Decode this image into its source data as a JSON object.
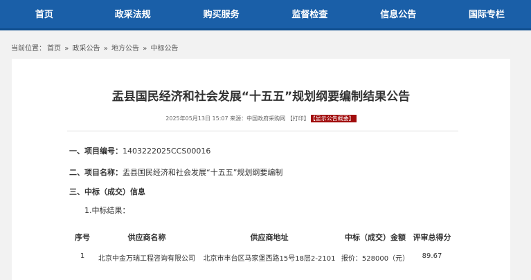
{
  "nav": {
    "items": [
      {
        "label": "首页"
      },
      {
        "label": "政采法规"
      },
      {
        "label": "购买服务"
      },
      {
        "label": "监督检查"
      },
      {
        "label": "信息公告"
      },
      {
        "label": "国际专栏"
      }
    ]
  },
  "breadcrumb": {
    "prefix": "当前位置：",
    "items": [
      "首页",
      "»",
      "政采公告",
      "»",
      "地方公告",
      "»",
      "中标公告"
    ]
  },
  "article": {
    "title": "盂县国民经济和社会发展“十五五”规划纲要编制结果公告",
    "meta": {
      "date": "2025年05月13日 15:07",
      "source_label": "来源：",
      "source": "中国政府采购网",
      "print_label": "【打印】",
      "summary_label": "【显示公告概要】"
    },
    "sections": {
      "project_no_label": "一、项目编号：",
      "project_no": "1403222025CCS00016",
      "project_name_label": "二、项目名称：",
      "project_name": "盂县国民经济和社会发展“十五五”规划纲要编制",
      "award_label": "三、中标（成交）信息",
      "result_label": "1.中标结果："
    },
    "table": {
      "headers": [
        "序号",
        "供应商名称",
        "供应商地址",
        "中标（成交）金额",
        "评审总得分"
      ],
      "rows": [
        [
          "1",
          "北京中金万瑞工程咨询有限公司",
          "北京市丰台区马家堡西路15号18层2-2101",
          "报价：528000（元）",
          "89.67"
        ]
      ]
    }
  }
}
